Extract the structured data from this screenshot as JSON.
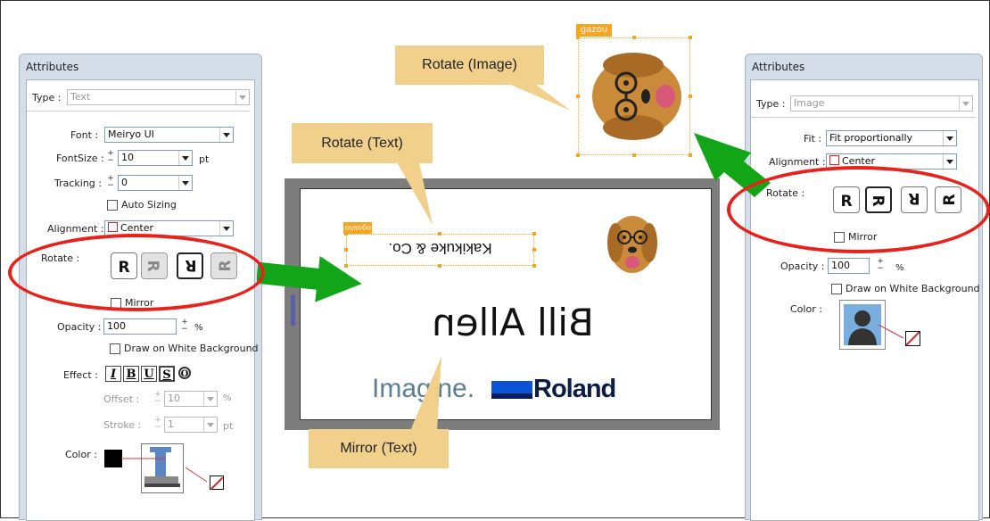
{
  "left_panel": {
    "title": "Attributes",
    "type_label": "Type :",
    "type_value": "Text",
    "font_label": "Font :",
    "font_value": "Meiryo UI",
    "fontsize_label": "FontSize :",
    "fontsize_value": "10",
    "fontsize_unit": "pt",
    "tracking_label": "Tracking :",
    "tracking_value": "0",
    "auto_sizing_label": "Auto Sizing",
    "alignment_label": "Alignment :",
    "alignment_value": "Center",
    "rotate_label": "Rotate :",
    "mirror_label": "Mirror",
    "opacity_label": "Opacity :",
    "opacity_value": "100",
    "opacity_unit": "%",
    "draw_white_label": "Draw on White Background",
    "effect_label": "Effect :",
    "effect_buttons": [
      "I",
      "B",
      "U",
      "S",
      "O"
    ],
    "offset_label": "Offset :",
    "offset_value": "10",
    "offset_unit": "%",
    "stroke_label": "Stroke :",
    "stroke_value": "1",
    "stroke_unit": "pt",
    "color_label": "Color :"
  },
  "right_panel": {
    "title": "Attributes",
    "type_label": "Type :",
    "type_value": "Image",
    "fit_label": "Fit :",
    "fit_value": "Fit proportionally",
    "alignment_label": "Alignment :",
    "alignment_value": "Center",
    "rotate_label": "Rotate :",
    "mirror_label": "Mirror",
    "opacity_label": "Opacity :",
    "opacity_value": "100",
    "opacity_unit": "%",
    "draw_white_label": "Draw on White Background",
    "color_label": "Color :"
  },
  "canvas": {
    "text_object_tag": "ogosho",
    "mirrored_company": "Kakikuke & Co.",
    "mirrored_name": "Bill Allen",
    "logo_imagine": "Imagine.",
    "logo_roland": "Roland"
  },
  "image_object": {
    "tag": "gazou"
  },
  "callouts": {
    "rotate_image": "Rotate (Image)",
    "rotate_text": "Rotate (Text)",
    "mirror_text": "Mirror (Text)"
  },
  "colors": {
    "callout_bg": "#f1d08c",
    "highlight_red": "#e8221b",
    "arrow_green": "#13a518",
    "selection_orange": "#f4a623",
    "panel_bg": "#d4dde8"
  }
}
